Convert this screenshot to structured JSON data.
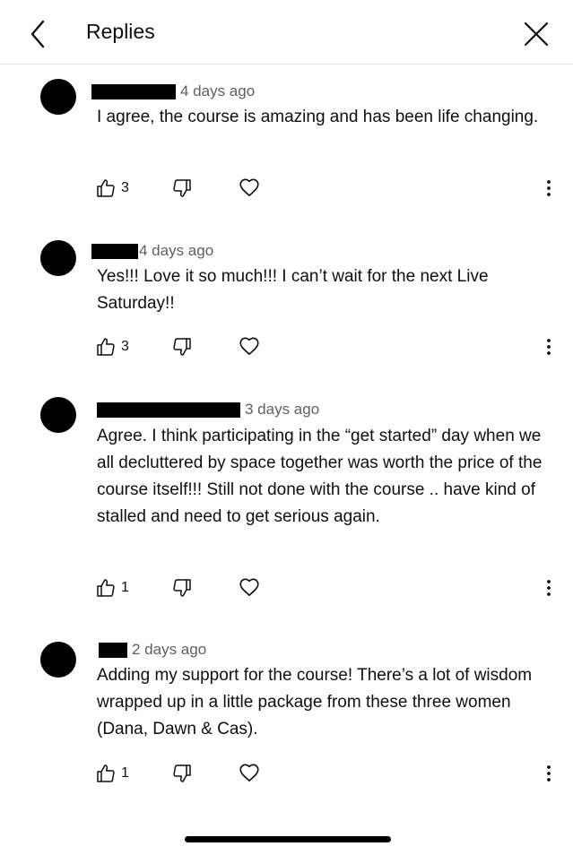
{
  "header": {
    "title": "Replies"
  },
  "comments": [
    {
      "time": "4 days ago",
      "text": "I agree, the course is amazing and has been life changing.",
      "likes": "3"
    },
    {
      "time": "4 days ago",
      "text": "Yes!!! Love it so much!!! I can’t wait for the next Live Saturday!!",
      "likes": "3"
    },
    {
      "time": "3 days ago",
      "text": "Agree. I think participating in the “get started” day when we all decluttered by space together was worth the price of the course itself!!! Still not done with the course .. have kind of stalled and need to get serious again.",
      "likes": "1"
    },
    {
      "time": "2 days ago",
      "text": "Adding my support for the course! There’s a lot of wisdom wrapped up in a little package from these three women (Dana, Dawn & Cas).",
      "likes": "1"
    }
  ],
  "icons": {
    "back": "back-arrow-icon",
    "close": "close-icon",
    "like": "thumbs-up-icon",
    "dislike": "thumbs-down-icon",
    "heart": "heart-icon",
    "more": "more-vert-icon"
  }
}
